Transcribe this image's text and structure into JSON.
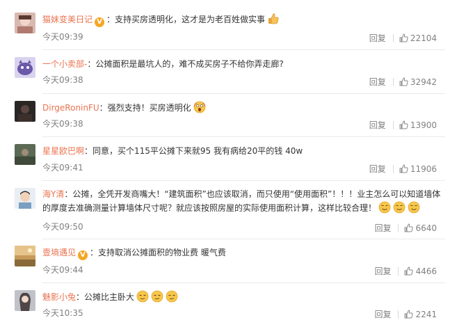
{
  "comments": [
    {
      "nick": "猫妹变美日记",
      "verified": true,
      "text": "：支持买房透明化，这才是为老百姓做实事",
      "emoji": [
        "thumbs-up"
      ],
      "time": "今天09:39",
      "reply": "回复",
      "likes": "22104"
    },
    {
      "nick": "一个小卖部-",
      "verified": false,
      "text": "：公摊面积是最坑人的，难不成买房子不给你弄走廊?",
      "emoji": [],
      "time": "今天09:38",
      "reply": "回复",
      "likes": "32942"
    },
    {
      "nick": "DirgeRoninFU",
      "verified": false,
      "text": "：强烈支持！买房透明化",
      "emoji": [
        "scream"
      ],
      "time": "今天09:38",
      "reply": "回复",
      "likes": "13900"
    },
    {
      "nick": "星星欧巴啊",
      "verified": false,
      "text": "：同意，买个115平公摊下来就95 我有病给20平的钱 40w",
      "emoji": [],
      "time": "今天09:41",
      "reply": "回复",
      "likes": "11906"
    },
    {
      "nick": "海Y清",
      "verified": false,
      "text": "：公摊，全凭开发商嘴大！“建筑面积”也应该取消，而只使用“使用面积”！！！业主怎么可以知道墙体的厚度去准确测量计算墙体尺寸呢？就应该按照房屋的实际使用面积计算，这样比较合理！",
      "emoji": [
        "smile",
        "smile",
        "smile"
      ],
      "time": "今天09:50",
      "reply": "回复",
      "likes": "6640"
    },
    {
      "nick": "壹墒遇见",
      "verified": true,
      "text": "：支持取消公摊面积的物业费 暖气费",
      "emoji": [],
      "time": "今天09:44",
      "reply": "回复",
      "likes": "4466"
    },
    {
      "nick": "魅影小兔",
      "verified": false,
      "text": "：公摊比主卧大",
      "emoji": [
        "smirk",
        "smirk",
        "smirk"
      ],
      "time": "今天10:35",
      "reply": "回复",
      "likes": "2241"
    }
  ],
  "colors": {
    "nick": "#eb7350",
    "meta": "#808080",
    "badge": "#f5a623"
  }
}
